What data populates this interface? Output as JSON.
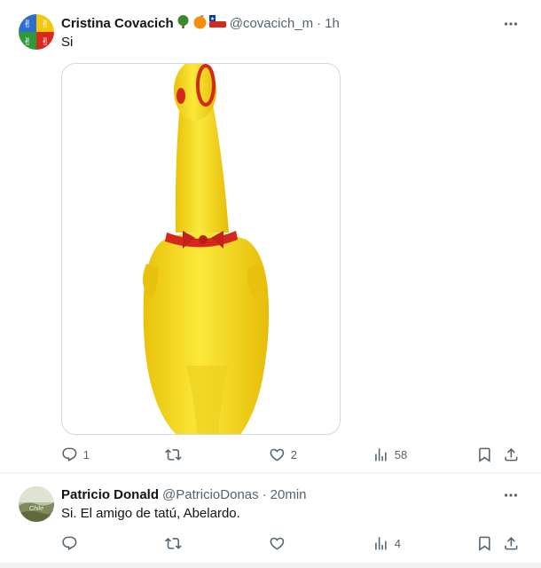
{
  "tweets": [
    {
      "name": "Cristina Covacich",
      "name_emojis": [
        "tree-emoji",
        "orange-emoji",
        "chile-flag-emoji"
      ],
      "handle": "@covacich_m",
      "separator": "·",
      "time": "1h",
      "text": "Si",
      "has_media": true,
      "media_description": "yellow rubber chicken toy",
      "stats": {
        "replies": "1",
        "retweets": "",
        "likes": "2",
        "views": "58"
      }
    },
    {
      "name": "Patricio Donald",
      "handle": "@PatricioDonas",
      "separator": "·",
      "time": "20min",
      "text": "Si. El amigo de tatú, Abelardo.",
      "has_media": false,
      "stats": {
        "replies": "",
        "retweets": "",
        "likes": "",
        "views": "4"
      }
    }
  ],
  "colors": {
    "text_primary": "#0f1419",
    "text_secondary": "#536471",
    "border": "#eff3f4",
    "media_border": "#cfd9de",
    "chicken_yellow": "#f7e01f",
    "chicken_red": "#d4281c"
  }
}
